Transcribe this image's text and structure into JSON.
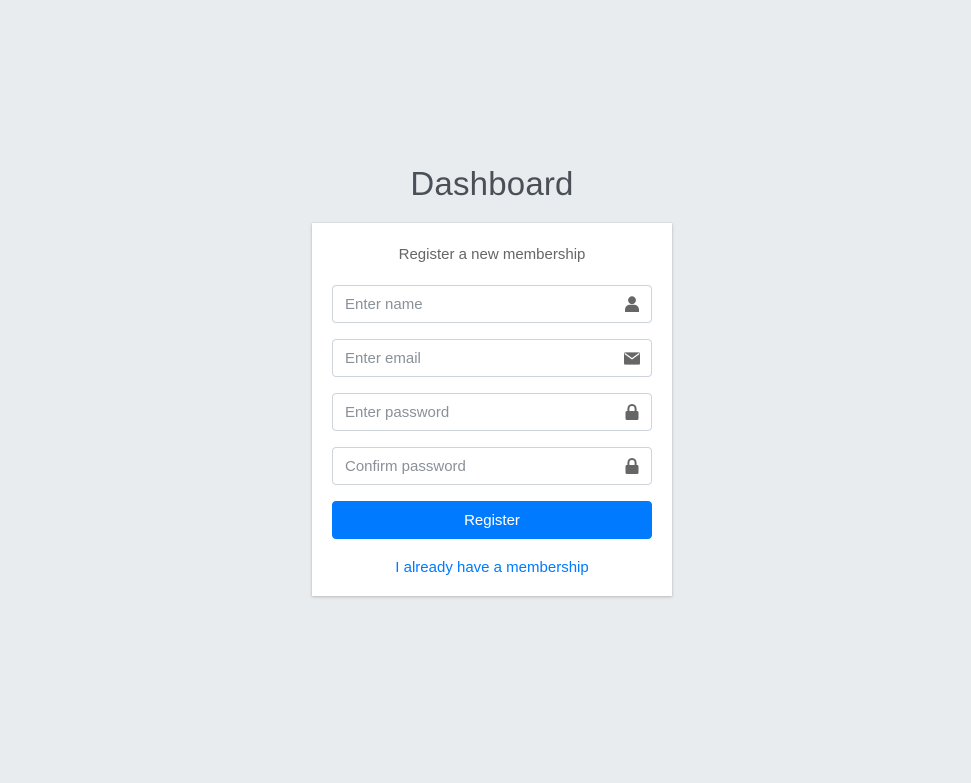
{
  "logo": {
    "title": "Dashboard"
  },
  "register": {
    "message": "Register a new membership",
    "fields": {
      "name": {
        "placeholder": "Enter name",
        "icon": "user-icon"
      },
      "email": {
        "placeholder": "Enter email",
        "icon": "envelope-icon"
      },
      "password": {
        "placeholder": "Enter password",
        "icon": "lock-icon"
      },
      "confirm": {
        "placeholder": "Confirm password",
        "icon": "lock-icon"
      }
    },
    "submit_label": "Register",
    "login_link": "I already have a membership"
  },
  "colors": {
    "background": "#e9ecef",
    "primary": "#007bff",
    "icon": "#666666"
  }
}
